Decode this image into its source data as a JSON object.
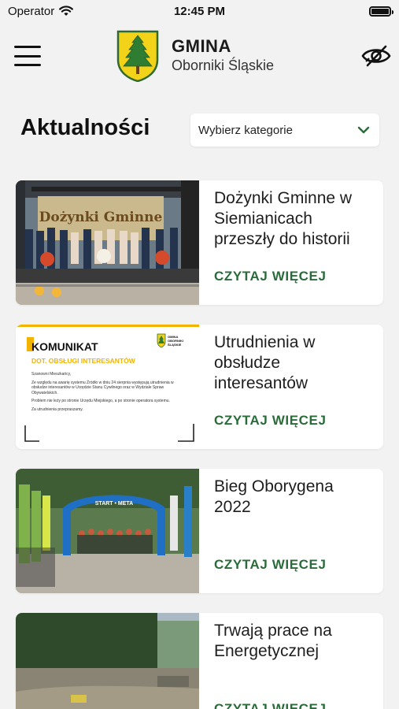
{
  "status_bar": {
    "carrier": "Operator",
    "time": "12:45 PM"
  },
  "header": {
    "title": "GMINA",
    "subtitle": "Oborniki Śląskie",
    "menu_icon": "hamburger-menu-icon",
    "accessibility_icon": "eye-slash-icon"
  },
  "page": {
    "title": "Aktualności",
    "category_select": {
      "placeholder": "Wybierz kategorie",
      "icon": "chevron-down-icon"
    }
  },
  "news": [
    {
      "title": "Dożynki Gminne w Siemianicach przeszły do historii",
      "link": "CZYTAJ WIĘCEJ"
    },
    {
      "title": "Utrudnienia w obsłudze interesantów",
      "link": "CZYTAJ WIĘCEJ"
    },
    {
      "title": "Bieg Oborygena 2022",
      "link": "CZYTAJ WIĘCEJ"
    },
    {
      "title": "Trwają prace na Energetycznej",
      "link": "CZYTAJ WIĘCEJ"
    }
  ],
  "komunikat": {
    "heading": "KOMUNIKAT",
    "subheading": "DOT. OBSŁUGI INTERESANTÓW",
    "logo_line1": "GMINA",
    "logo_line2": "OBORNIKI",
    "logo_line3": "ŚLĄSKIE",
    "greeting": "Szanowni Mieszkańcy,",
    "para1": "Ze względu na awarię systemu Źródło w dniu 24 sierpnia występują utrudnienia w obsłudze interesantów w Urzędzie Stanu Cywilnego oraz w Wydziale Spraw Obywatelskich.",
    "para2": "Problem nie leży po stronie Urzędu Miejskiego, a po stronie operatora systemu.",
    "closing": "Za utrudnienia przepraszamy."
  },
  "photo_text": {
    "banner": "Dożynki Gminne",
    "arch": "START • META"
  },
  "colors": {
    "accent_green": "#2a6b3a",
    "background": "#f2f2f2",
    "card": "#ffffff",
    "komunikat_yellow": "#f2b400"
  }
}
